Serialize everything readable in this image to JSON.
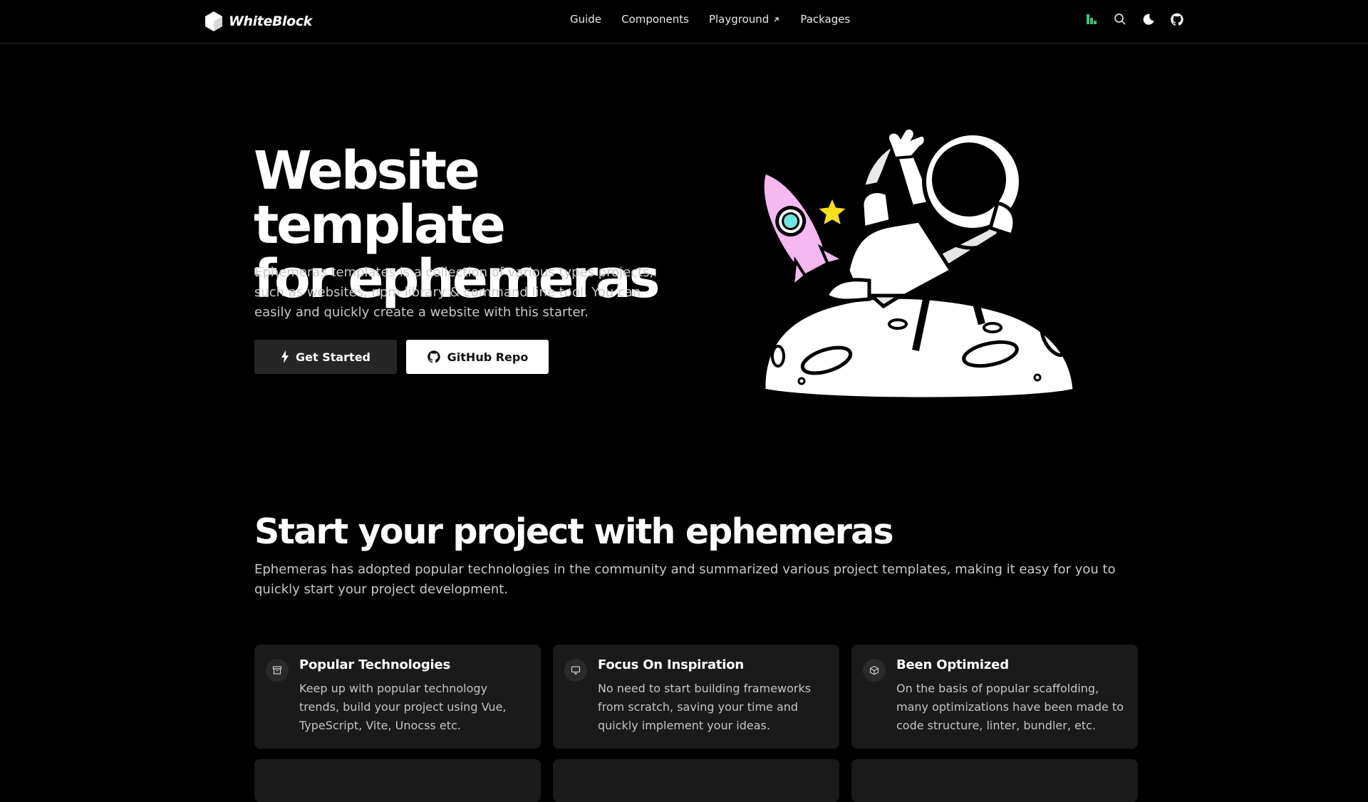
{
  "nav": {
    "brand": "WhiteBlock",
    "links": [
      {
        "label": "Guide"
      },
      {
        "label": "Components"
      },
      {
        "label": "Playground",
        "external": true
      },
      {
        "label": "Packages"
      }
    ],
    "icons": [
      "stackblitz-icon",
      "search-icon",
      "moon-icon",
      "github-icon"
    ]
  },
  "hero": {
    "title_line1": "Website template",
    "title_line2": "for ephemeras",
    "description": "Ephemeras templates is a collection of various types projects, such as websites, npm library & command line tool. You can easily and quickly create a website with this starter.",
    "primary_button": "Get Started",
    "secondary_button": "GitHub Repo"
  },
  "features": {
    "title": "Start your project with ephemeras",
    "description": "Ephemeras has adopted popular technologies in the community and summarized various project templates, making it easy for you to quickly start your project development.",
    "cards": [
      {
        "icon": "archive-icon",
        "title": "Popular Technologies",
        "text": "Keep up with popular technology trends, build your project using Vue, TypeScript, Vite, Unocss etc."
      },
      {
        "icon": "monitor-icon",
        "title": "Focus On Inspiration",
        "text": "No need to start building frameworks from scratch, saving your time and quickly implement your ideas."
      },
      {
        "icon": "cube-icon",
        "title": "Been Optimized",
        "text": "On the basis of popular scaffolding, many optimizations have been made to code structure, linter, bundler, etc."
      }
    ]
  },
  "colors": {
    "background": "#000000",
    "card": "#1a1a1a",
    "accent_green": "#3fbf6f",
    "rocket_pink": "#f5b8f0",
    "star_yellow": "#f7e01b"
  }
}
